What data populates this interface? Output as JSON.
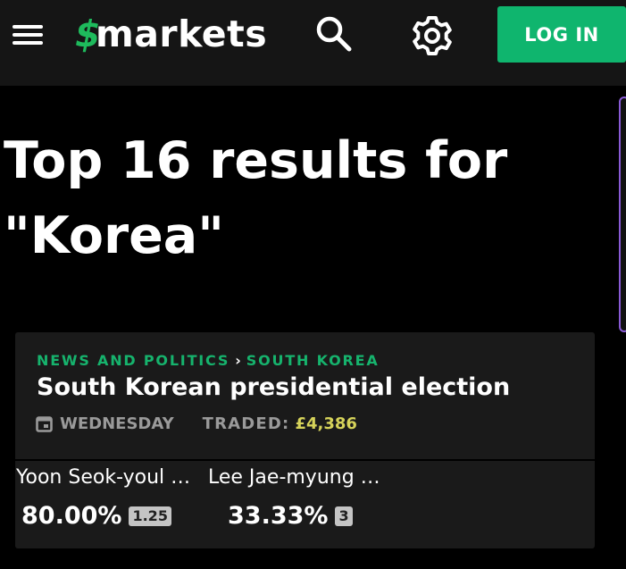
{
  "header": {
    "logo_text": "markets",
    "logo_mark": "$",
    "login_label": "LOG IN",
    "icons": [
      "menu-icon",
      "search-icon",
      "gear-icon"
    ]
  },
  "page": {
    "title": "Top 16 results for \"Korea\""
  },
  "results": [
    {
      "category": "NEWS AND POLITICS",
      "subcategory": "SOUTH KOREA",
      "title": "South Korean presidential election",
      "day": "WEDNESDAY",
      "traded_label": "TRADED:",
      "traded_value": "£4,386",
      "outcomes": [
        {
          "name": "Yoon Seok-youl …",
          "price": "80.00%",
          "odds": "1.25"
        },
        {
          "name": "Lee Jae-myung …",
          "price": "33.33%",
          "odds": "3"
        }
      ]
    }
  ],
  "colors": {
    "accent_green": "#0fb56e",
    "category_green": "#16b36d",
    "traded_yellow": "#d6d35a",
    "card_bg": "#1a1a1a",
    "header_bg": "#151515"
  }
}
